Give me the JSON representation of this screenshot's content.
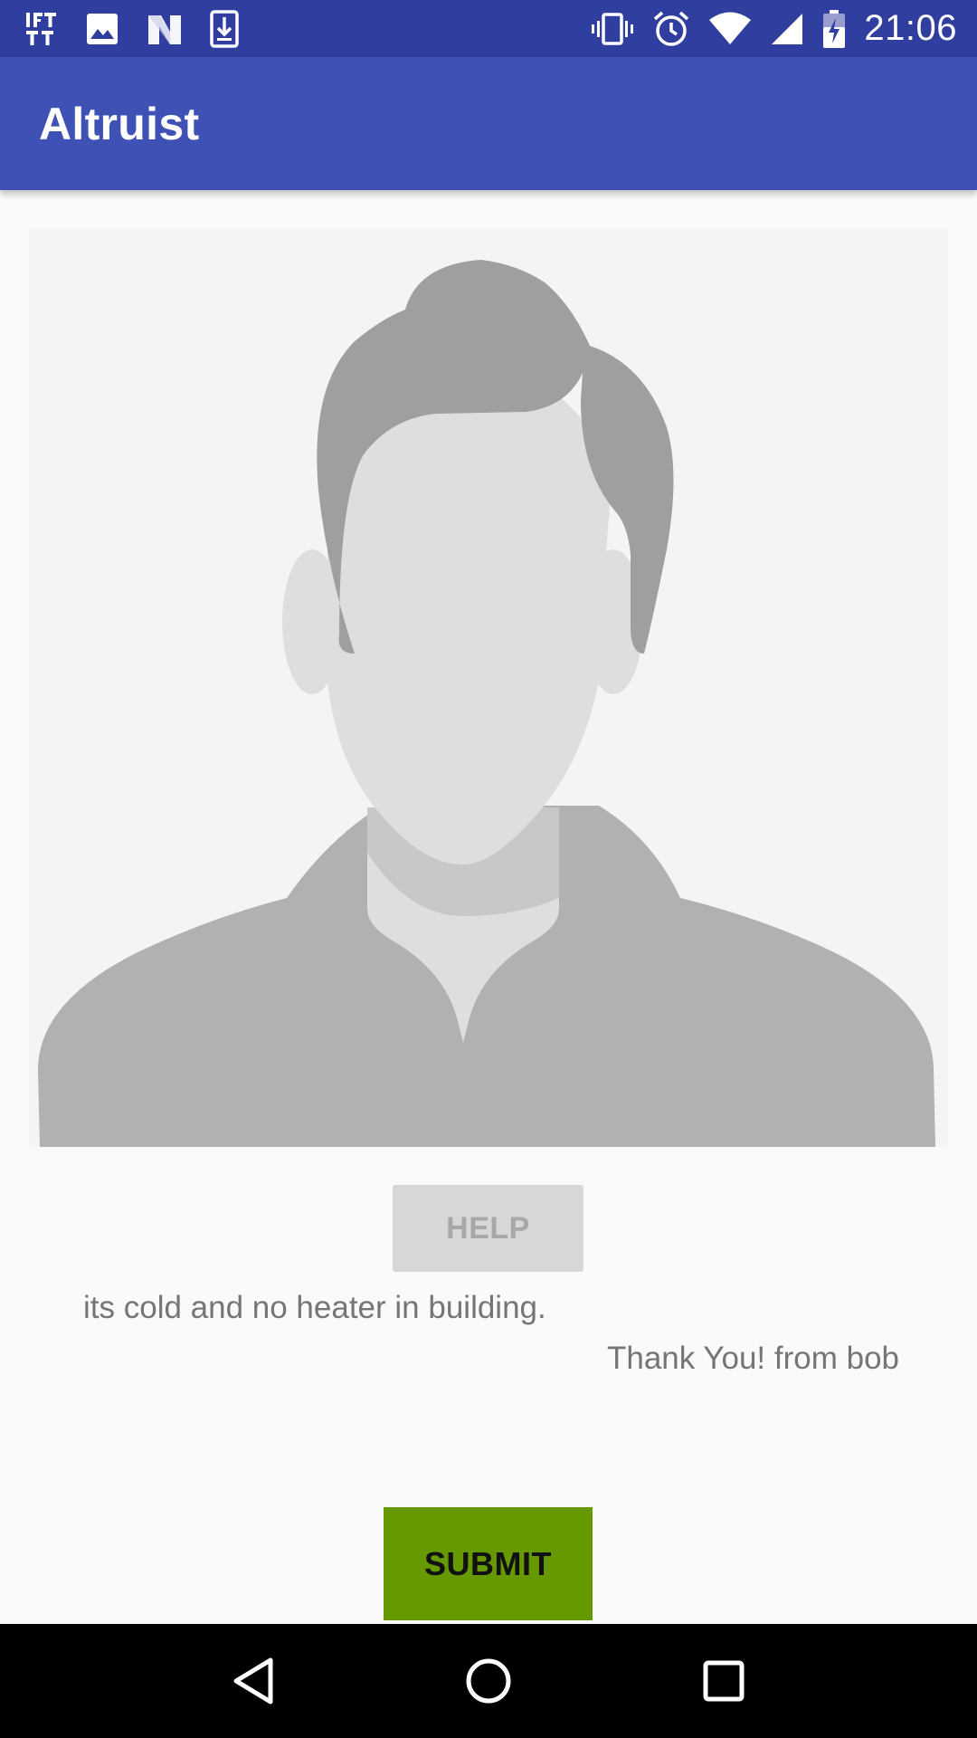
{
  "status_bar": {
    "time": "21:06",
    "left_icons": [
      "ifttt-icon",
      "image-icon",
      "n-logo-icon",
      "download-icon"
    ],
    "right_icons": [
      "vibrate-icon",
      "alarm-icon",
      "wifi-icon",
      "signal-icon",
      "battery-charging-icon"
    ]
  },
  "app_bar": {
    "title": "Altruist"
  },
  "profile": {
    "image": "default-avatar-icon"
  },
  "help_button": {
    "label": "HELP"
  },
  "request": {
    "message": "its cold and no heater in building."
  },
  "thanks": {
    "message": "Thank You! from bob"
  },
  "submit_button": {
    "label": "SUBMIT"
  },
  "colors": {
    "status_bar": "#303f9f",
    "app_bar": "#3f51b5",
    "submit": "#669900",
    "help_disabled": "#d6d7d7"
  },
  "nav_bar": {
    "buttons": [
      "back-icon",
      "home-icon",
      "recents-icon"
    ]
  }
}
